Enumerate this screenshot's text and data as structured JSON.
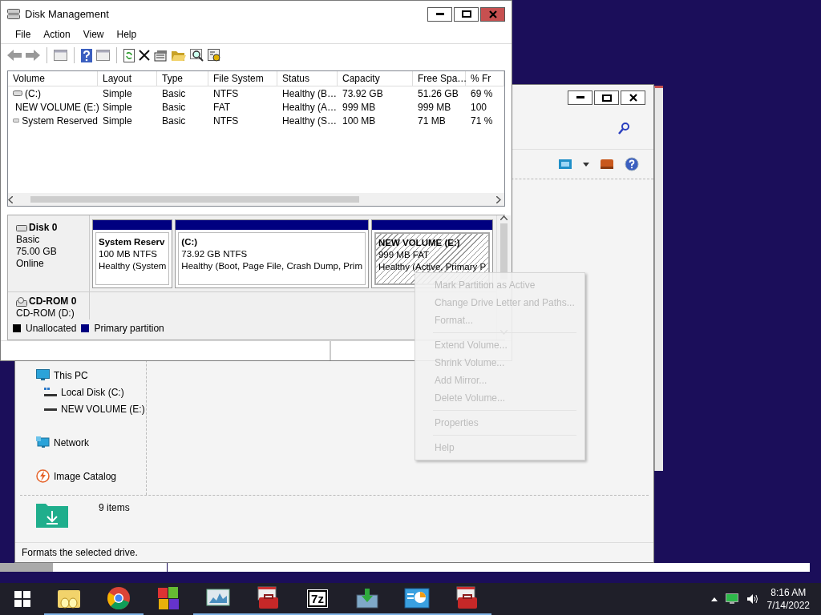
{
  "disk_management": {
    "title": "Disk Management",
    "menu": [
      "File",
      "Action",
      "View",
      "Help"
    ],
    "columns": [
      "Volume",
      "Layout",
      "Type",
      "File System",
      "Status",
      "Capacity",
      "Free Spa…",
      "% Fr"
    ],
    "rows": [
      [
        "(C:)",
        "Simple",
        "Basic",
        "NTFS",
        "Healthy (B…",
        "73.92 GB",
        "51.26 GB",
        "69 %"
      ],
      [
        "NEW VOLUME (E:)",
        "Simple",
        "Basic",
        "FAT",
        "Healthy (A…",
        "999 MB",
        "999 MB",
        "100"
      ],
      [
        "System Reserved",
        "Simple",
        "Basic",
        "NTFS",
        "Healthy (S…",
        "100 MB",
        "71 MB",
        "71 %"
      ]
    ],
    "disks": [
      {
        "name": "Disk 0",
        "type": "Basic",
        "size": "75.00 GB",
        "state": "Online",
        "partitions": [
          {
            "name": "System Reserv",
            "detail": "100 MB NTFS",
            "status": "Healthy (System",
            "selected": false
          },
          {
            "name": "(C:)",
            "detail": "73.92 GB NTFS",
            "status": "Healthy (Boot, Page File, Crash Dump, Prim",
            "selected": false
          },
          {
            "name": "NEW VOLUME  (E:)",
            "detail": "999 MB FAT",
            "status": "Healthy (Active, Primary P",
            "selected": true
          }
        ]
      }
    ],
    "cdrom": {
      "name": "CD-ROM 0",
      "drive": "CD-ROM (D:)"
    },
    "legend": [
      {
        "label": "Unallocated",
        "color": "#000000"
      },
      {
        "label": "Primary partition",
        "color": "#000080"
      }
    ]
  },
  "context_menu": [
    {
      "kind": "item",
      "label": "Mark Partition as Active"
    },
    {
      "kind": "item",
      "label": "Change Drive Letter and Paths..."
    },
    {
      "kind": "item",
      "label": "Format..."
    },
    {
      "kind": "separator"
    },
    {
      "kind": "item",
      "label": "Extend Volume..."
    },
    {
      "kind": "item",
      "label": "Shrink Volume..."
    },
    {
      "kind": "item",
      "label": "Add Mirror..."
    },
    {
      "kind": "item",
      "label": "Delete Volume..."
    },
    {
      "kind": "separator"
    },
    {
      "kind": "item",
      "label": "Properties"
    },
    {
      "kind": "separator"
    },
    {
      "kind": "item",
      "label": "Help"
    }
  ],
  "explorer": {
    "nav": [
      {
        "kind": "pc",
        "label": "This PC",
        "children": [
          {
            "kind": "disk",
            "label": "Local Disk (C:)"
          },
          {
            "kind": "drive",
            "label": "NEW VOLUME (E:)"
          }
        ]
      },
      {
        "kind": "network",
        "label": "Network"
      },
      {
        "kind": "catalog",
        "label": "Image Catalog"
      }
    ],
    "item_count": "9 items",
    "status": "Formats the selected drive."
  },
  "taskbar": {
    "apps": [
      {
        "kind": "folder",
        "running": true
      },
      {
        "kind": "browser",
        "running": true
      },
      {
        "kind": "tiles",
        "running": false
      },
      {
        "kind": "monitor",
        "running": true
      },
      {
        "kind": "toolbox",
        "running": true
      },
      {
        "kind": "archive",
        "label": "7z",
        "running": true
      },
      {
        "kind": "download",
        "running": true
      },
      {
        "kind": "presentation",
        "running": true
      },
      {
        "kind": "toolbox",
        "running": true
      }
    ],
    "time": "8:16 AM",
    "date": "7/14/2022"
  }
}
